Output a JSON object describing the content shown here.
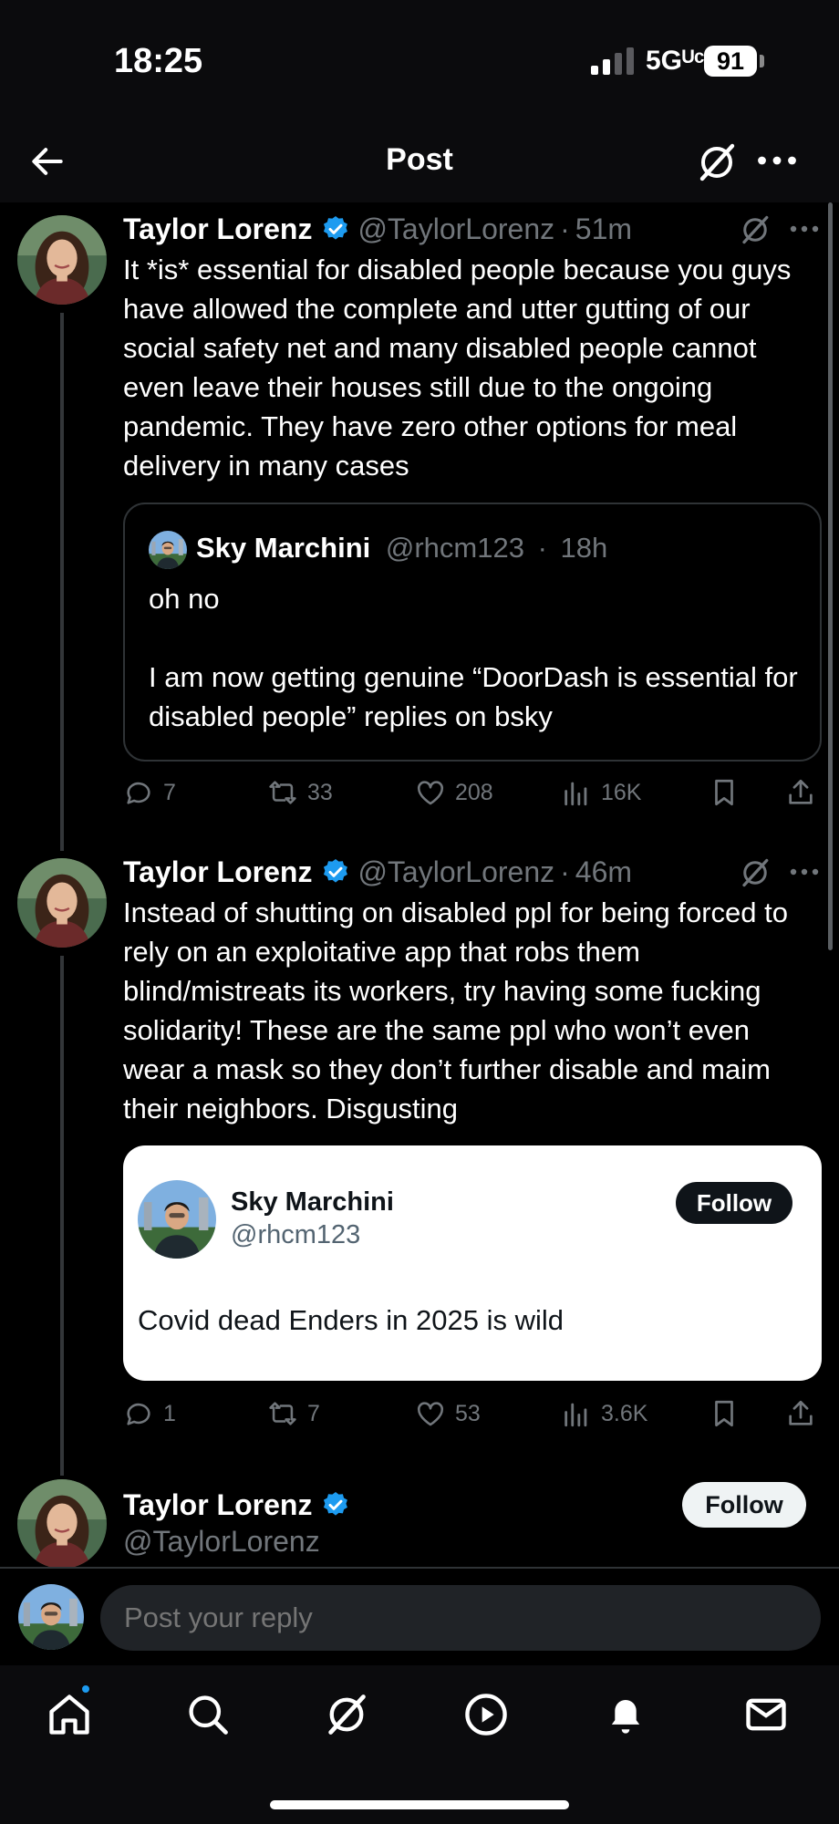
{
  "status_bar": {
    "time": "18:25",
    "network": "5GᵁᶜC",
    "battery": "91"
  },
  "header": {
    "title": "Post"
  },
  "posts": [
    {
      "author": "Taylor Lorenz",
      "handle": "@TaylorLorenz",
      "time": "51m",
      "text": "It *is* essential for disabled people because you guys have allowed the complete and utter gutting of our social safety net and many disabled people cannot even leave their houses still due to the ongoing pandemic. They have zero other options for meal delivery in many cases",
      "quote": {
        "author": "Sky Marchini",
        "handle": "@rhcm123",
        "time": "18h",
        "text": "oh no\n\nI am now getting genuine “DoorDash is essential for disabled people” replies on bsky"
      },
      "stats": {
        "replies": "7",
        "reposts": "33",
        "likes": "208",
        "views": "16K"
      }
    },
    {
      "author": "Taylor Lorenz",
      "handle": "@TaylorLorenz",
      "time": "46m",
      "text": "Instead of shutting on disabled ppl for being forced to rely on an exploitative app that robs them blind/mistreats its workers, try having some fucking solidarity! These are the same ppl who won’t even wear a mask so they don’t further disable and maim their neighbors. Disgusting",
      "card": {
        "name": "Sky Marchini",
        "handle": "@rhcm123",
        "follow": "Follow",
        "text": "Covid dead Enders in 2025 is wild"
      },
      "stats": {
        "replies": "1",
        "reposts": "7",
        "likes": "53",
        "views": "3.6K"
      }
    }
  ],
  "third_post": {
    "author": "Taylor Lorenz",
    "handle": "@TaylorLorenz",
    "follow": "Follow"
  },
  "reply": {
    "placeholder": "Post your reply"
  },
  "icons": [
    "back-arrow-icon",
    "grok-icon",
    "more-icon",
    "verified-icon",
    "reply-icon",
    "repost-icon",
    "like-icon",
    "views-icon",
    "bookmark-icon",
    "share-icon",
    "home-icon",
    "search-icon",
    "grok-icon",
    "video-icon",
    "bell-icon",
    "mail-icon"
  ],
  "colors": {
    "accent": "#1d9bf0",
    "muted": "#71767b",
    "background": "#000000"
  }
}
